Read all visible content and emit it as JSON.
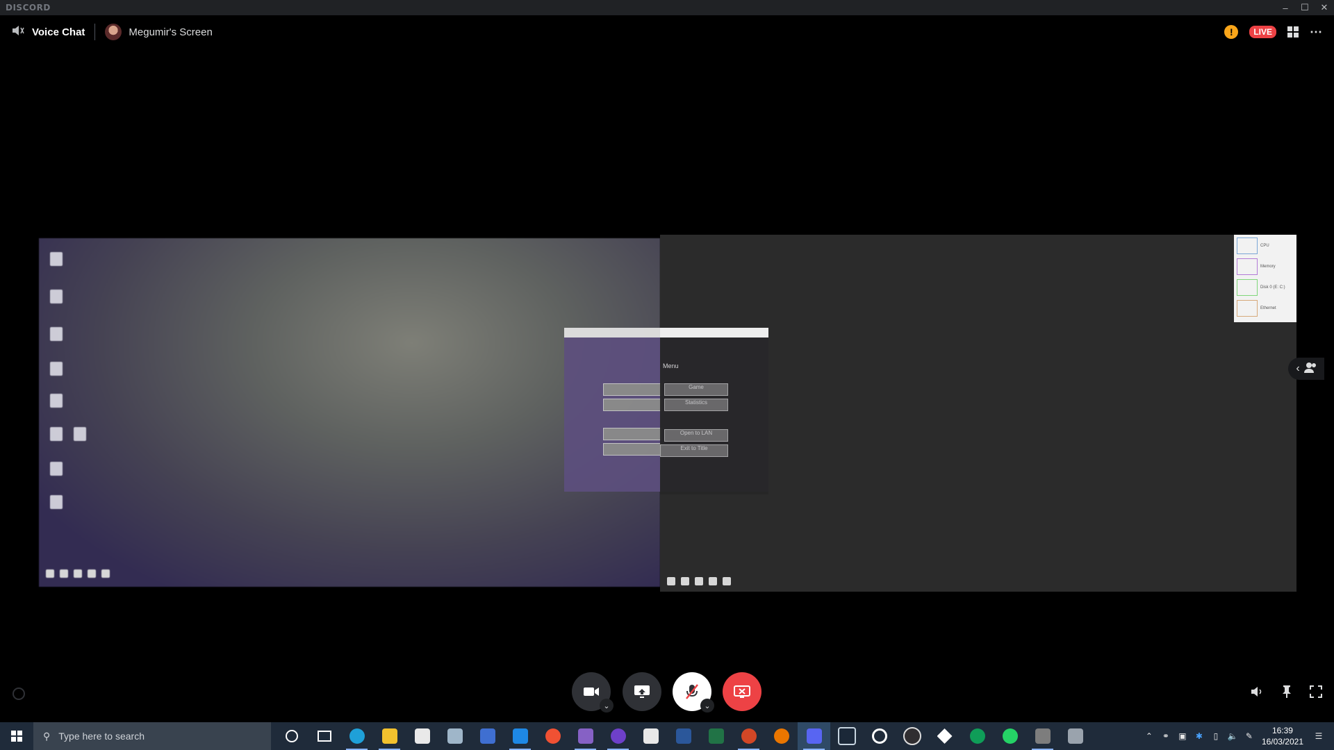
{
  "window": {
    "brand": "DISCORD",
    "minimize_icon": "minimize-icon",
    "maximize_icon": "maximize-icon",
    "close_icon": "close-icon"
  },
  "header": {
    "channel_type_icon": "speaker-icon",
    "title": "Voice Chat",
    "stream_name": "Megumir's Screen",
    "live_badge": "LIVE"
  },
  "stream": {
    "minecraft_menu": {
      "title_partial": "Menu",
      "buttons": [
        "Game",
        "Statistics",
        "Open to LAN",
        "Exit to Title"
      ]
    },
    "task_manager": {
      "rows": [
        "CPU",
        "Memory",
        "Disk 0 (E: C:)",
        "Ethernet"
      ]
    }
  },
  "controls": {
    "camera": "camera-icon",
    "share_screen": "screen-share-icon",
    "mute": "microphone-muted-icon",
    "stop_stream": "stop-streaming-icon"
  },
  "taskbar": {
    "search_placeholder": "Type here to search",
    "time": "16:39",
    "date": "16/03/2021",
    "apps": [
      "cortana",
      "task-view",
      "edge",
      "file-explorer",
      "store",
      "mail",
      "app",
      "vscode",
      "git-tool",
      "visual-studio",
      "github",
      "file-app",
      "word",
      "excel",
      "powerpoint",
      "blender",
      "discord",
      "steam",
      "app-circle",
      "obs",
      "unity",
      "hangouts",
      "whatsapp",
      "app-box",
      "app-screen"
    ],
    "accent": "#8ab4f8"
  },
  "colors": {
    "live": "#ed4245",
    "warning": "#faa61a",
    "end_call": "#ed4245"
  }
}
